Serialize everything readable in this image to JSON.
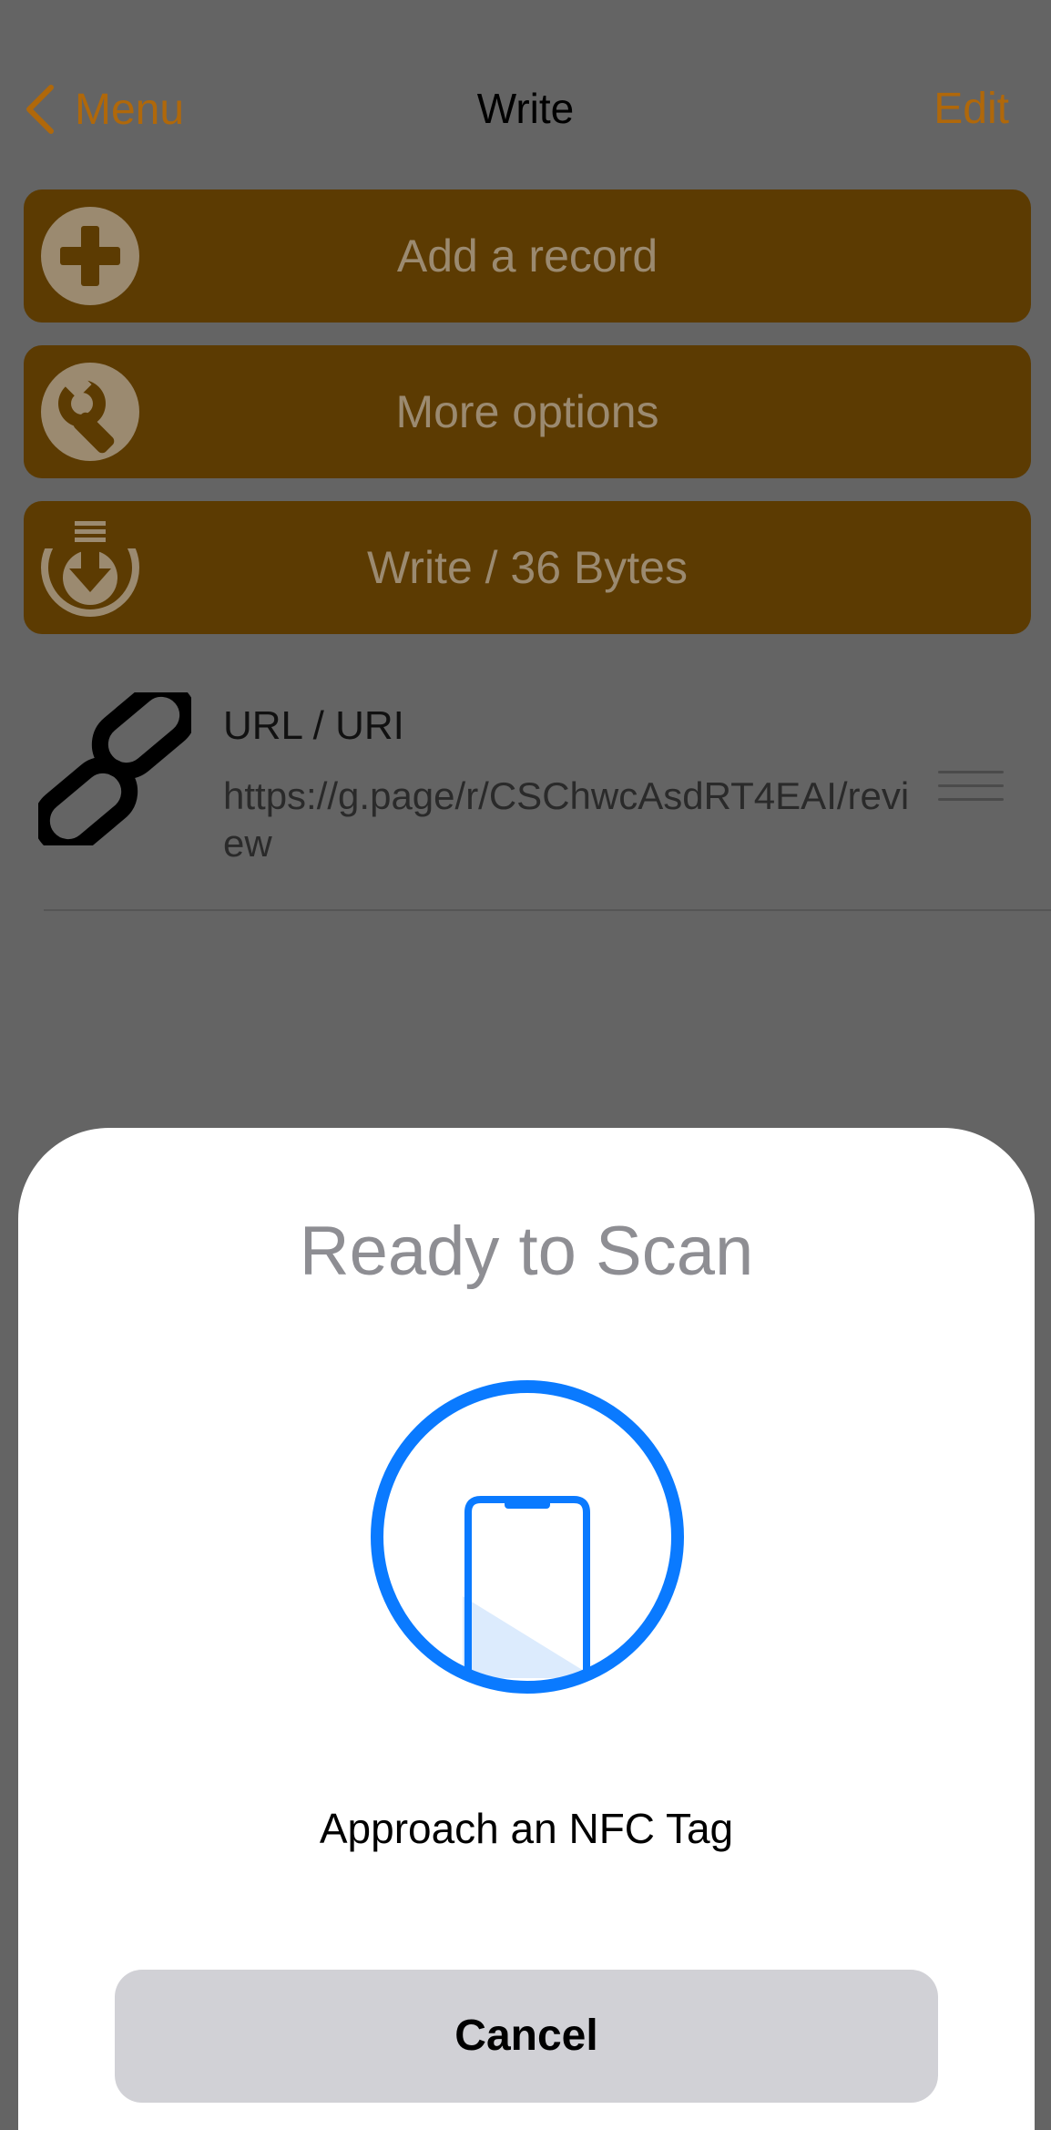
{
  "nav": {
    "back_label": "Menu",
    "title": "Write",
    "edit_label": "Edit"
  },
  "actions": [
    {
      "label": "Add a record",
      "icon": "plus-circle-icon"
    },
    {
      "label": "More options",
      "icon": "wrench-icon"
    },
    {
      "label": "Write / 36 Bytes",
      "icon": "download-arrow-icon"
    }
  ],
  "records": [
    {
      "type": "URL / URI",
      "value": "https://g.page/r/CSChwcAsdRT4EAI/review",
      "icon": "link-icon"
    }
  ],
  "sheet": {
    "title": "Ready to Scan",
    "message": "Approach an NFC Tag",
    "cancel_label": "Cancel",
    "icon": "phone-scan-icon"
  },
  "colors": {
    "accent": "#b0680a",
    "button_bg": "#5c3b02",
    "button_text": "#9b8a70",
    "overlay_bg": "#646464",
    "scan_blue": "#0a7aff",
    "cancel_bg": "#d1d1d6"
  }
}
